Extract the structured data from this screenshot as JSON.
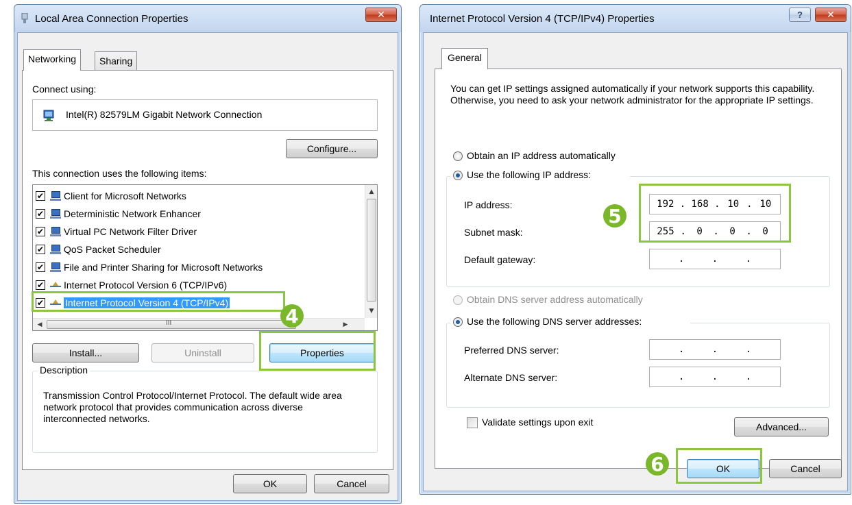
{
  "left_window": {
    "title": "Local Area Connection Properties",
    "close_label": "✕",
    "tabs": [
      "Networking",
      "Sharing"
    ],
    "connect_using_label": "Connect using:",
    "adapter_name": "Intel(R) 82579LM Gigabit Network Connection",
    "configure_label": "Configure...",
    "items_label": "This connection uses the following items:",
    "items": [
      {
        "label": "Client for Microsoft Networks",
        "checked": true
      },
      {
        "label": "Deterministic Network Enhancer",
        "checked": true
      },
      {
        "label": "Virtual PC Network Filter Driver",
        "checked": true
      },
      {
        "label": "QoS Packet Scheduler",
        "checked": true
      },
      {
        "label": "File and Printer Sharing for Microsoft Networks",
        "checked": true
      },
      {
        "label": "Internet Protocol Version 6 (TCP/IPv6)",
        "checked": true
      },
      {
        "label": "Internet Protocol Version 4 (TCP/IPv4)",
        "checked": true
      }
    ],
    "scroll_marker": "III",
    "install_label": "Install...",
    "uninstall_label": "Uninstall",
    "properties_label": "Properties",
    "description_title": "Description",
    "description_text": "Transmission Control Protocol/Internet Protocol. The default wide area network protocol that provides communication across diverse interconnected networks.",
    "ok_label": "OK",
    "cancel_label": "Cancel",
    "step_badge": "4"
  },
  "right_window": {
    "title": "Internet Protocol Version 4 (TCP/IPv4) Properties",
    "help_label": "?",
    "close_label": "✕",
    "tab": "General",
    "intro_text": "You can get IP settings assigned automatically if your network supports this capability. Otherwise, you need to ask your network administrator for the appropriate IP settings.",
    "obtain_ip_auto": "Obtain an IP address automatically",
    "use_following_ip": "Use the following IP address:",
    "ip_address_label": "IP address:",
    "ip_address": [
      "192",
      "168",
      "10",
      "10"
    ],
    "subnet_label": "Subnet mask:",
    "subnet_mask": [
      "255",
      "0",
      "0",
      "0"
    ],
    "gateway_label": "Default gateway:",
    "obtain_dns_auto": "Obtain DNS server address automatically",
    "use_following_dns": "Use the following DNS server addresses:",
    "preferred_dns_label": "Preferred DNS server:",
    "alternate_dns_label": "Alternate DNS server:",
    "validate_label": "Validate settings upon exit",
    "advanced_label": "Advanced...",
    "ok_label": "OK",
    "cancel_label": "Cancel",
    "step_badge_ip": "5",
    "step_badge_ok": "6"
  },
  "colors": {
    "highlight_green": "#8cc63f",
    "badge_green": "#7ab829",
    "selection_blue": "#3399ff"
  }
}
